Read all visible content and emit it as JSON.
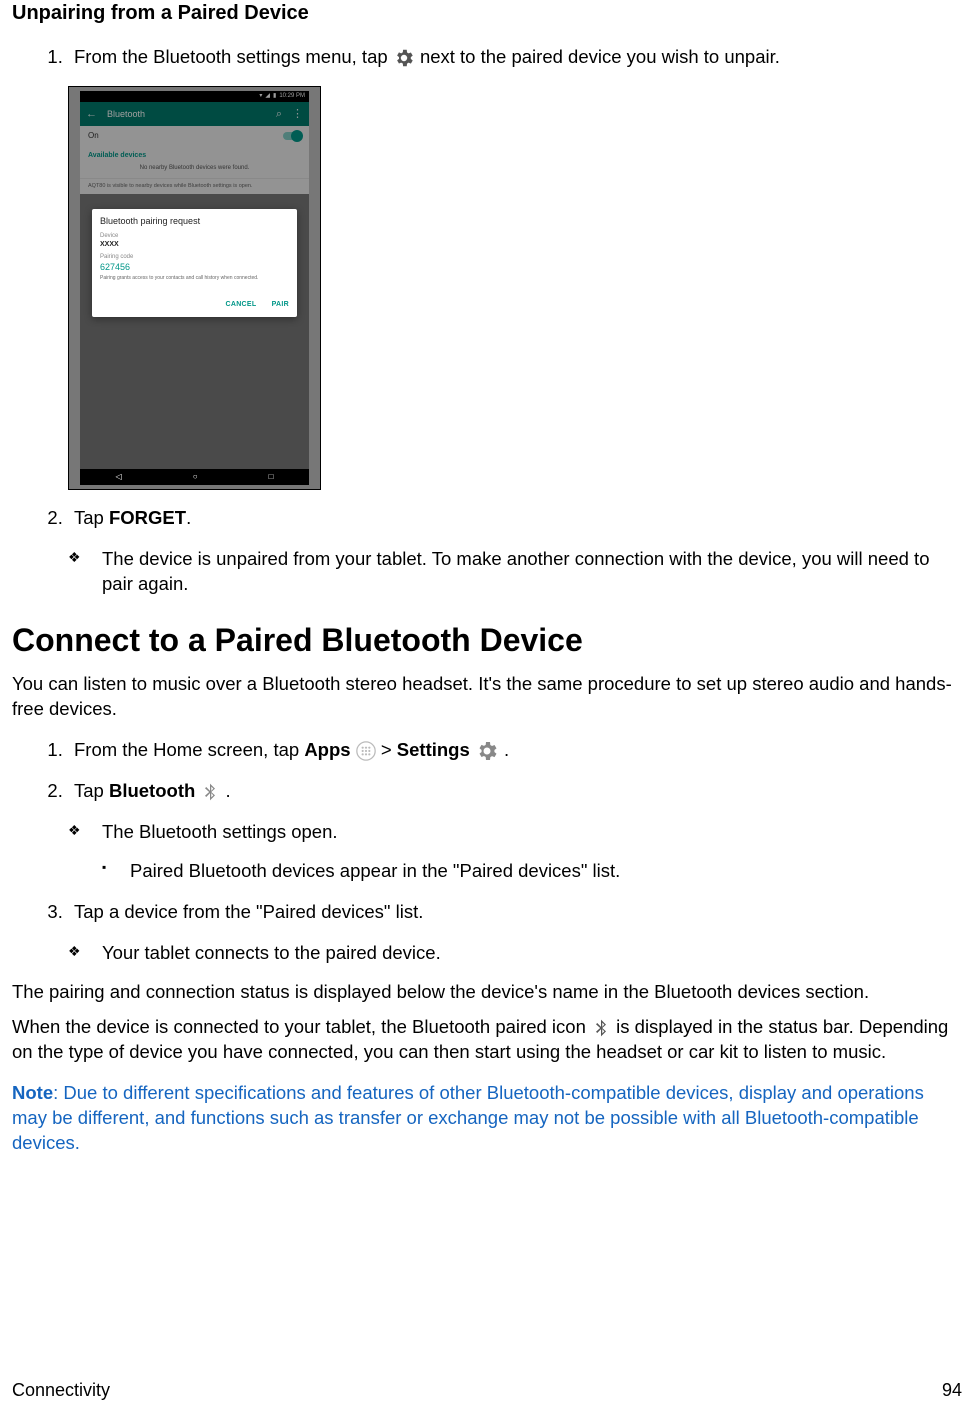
{
  "heading1": "Unpairing from a Paired Device",
  "step1_a": "From the Bluetooth settings menu, tap ",
  "step1_b": " next to the paired device you wish to unpair.",
  "step2_a": "Tap ",
  "step2_forget": "FORGET",
  "step2_b": ".",
  "step2_note": "The device is unpaired from your tablet. To make another connection with the device, you will need to pair again.",
  "heading2": "Connect to a Paired Bluetooth Device",
  "intro2": "You can listen to music over a Bluetooth stereo headset. It's the same procedure to set up stereo audio and hands-free devices.",
  "s2_step1_a": "From the Home screen, tap ",
  "s2_step1_apps": "Apps",
  "s2_step1_gt": " > ",
  "s2_step1_settings": "Settings",
  "s2_step1_end": " .",
  "s2_step2_a": "Tap ",
  "s2_step2_bt": "Bluetooth",
  "s2_step2_end": "  .",
  "s2_step2_sub1": "The Bluetooth settings open.",
  "s2_step2_sub1a": "Paired Bluetooth devices appear in the \"Paired devices\" list.",
  "s2_step3": "Tap a device from the \"Paired devices\" list.",
  "s2_step3_sub": "Your tablet connects to the paired device.",
  "body_status": "The pairing and connection status is displayed below the device's name in the Bluetooth devices section.",
  "body_icon_a": "When the device is connected to your tablet, the Bluetooth paired icon ",
  "body_icon_b": " is displayed in the status bar. Depending on the type of device you have connected, you can then start using the headset or car kit to listen to music.",
  "note_label": "Note",
  "note_body": ": Due to different specifications and features of other Bluetooth-compatible devices, display and operations may be different, and functions such as transfer or exchange may not be possible with all Bluetooth-compatible devices.",
  "footer_section": "Connectivity",
  "footer_page": "94",
  "shot": {
    "time": "10:29 PM",
    "title": "Bluetooth",
    "on": "On",
    "available": "Available devices",
    "none": "No nearby Bluetooth devices were found.",
    "visible": "AQT80 is visible to nearby devices while Bluetooth settings is open.",
    "dlg_title": "Bluetooth pairing request",
    "lbl_device": "Device",
    "val_device": "XXXX",
    "lbl_code": "Pairing code",
    "val_code": "627456",
    "hint": "Pairing grants access to your contacts and call history when connected.",
    "cancel": "CANCEL",
    "pair": "PAIR"
  }
}
